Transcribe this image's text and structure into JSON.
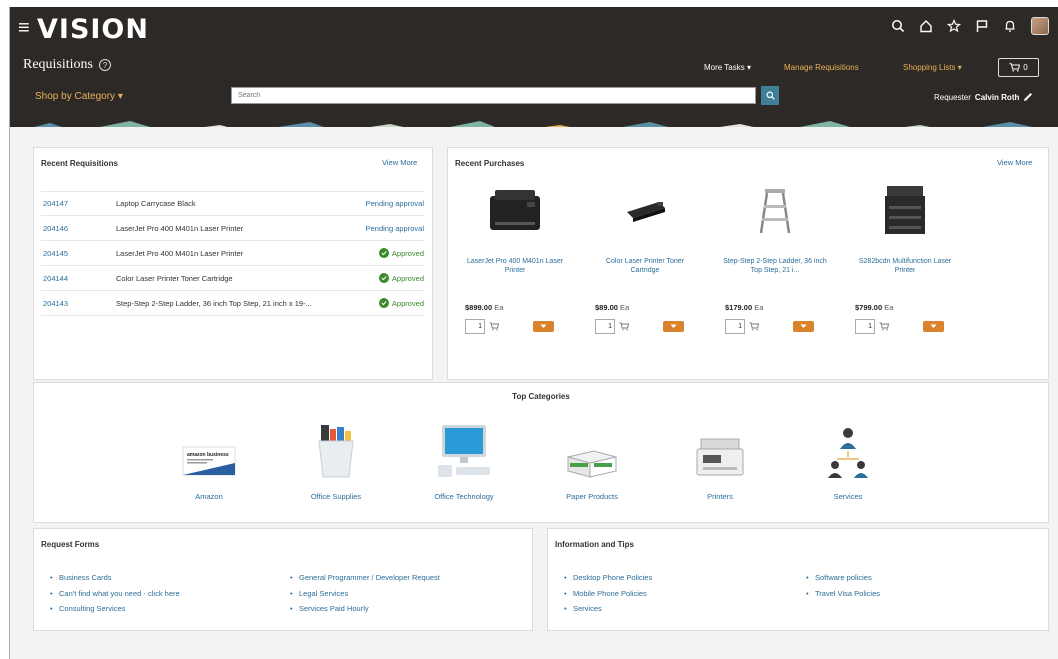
{
  "app": {
    "logo": "VISION",
    "page_title": "Requisitions",
    "icons": [
      "hamburger-icon",
      "search-icon",
      "home-icon",
      "star-icon",
      "flag-icon",
      "bell-icon",
      "avatar"
    ]
  },
  "header": {
    "more_tasks": "More Tasks ▾",
    "manage_requisitions": "Manage Requisitions",
    "shopping_lists": "Shopping Lists ▾",
    "cart_count": "0",
    "shop_by_category": "Shop by Category ▾",
    "search_placeholder": "Search",
    "requester_label": "Requester",
    "requester_name": "Calvin Roth"
  },
  "recent_requisitions": {
    "title": "Recent Requisitions",
    "view_more": "View More",
    "rows": [
      {
        "id": "204147",
        "desc": "Laptop Carrycase Black",
        "status": "Pending approval",
        "approved": false
      },
      {
        "id": "204146",
        "desc": "LaserJet Pro 400 M401n Laser Printer",
        "status": "Pending approval",
        "approved": false
      },
      {
        "id": "204145",
        "desc": "LaserJet Pro 400 M401n Laser Printer",
        "status": "Approved",
        "approved": true
      },
      {
        "id": "204144",
        "desc": "Color Laser Printer Toner Cartridge",
        "status": "Approved",
        "approved": true
      },
      {
        "id": "204143",
        "desc": "Step-Step 2-Step Ladder, 36 inch Top Step, 21 inch x 19-...",
        "status": "Approved",
        "approved": true
      }
    ]
  },
  "recent_purchases": {
    "title": "Recent Purchases",
    "view_more": "View More",
    "items": [
      {
        "name": "LaserJet Pro 400 M401n Laser Printer",
        "price": "$899.00",
        "uom": "Ea",
        "qty": "1",
        "icon": "laser-printer-image"
      },
      {
        "name": "Color Laser Printer Toner Cartridge",
        "price": "$89.00",
        "uom": "Ea",
        "qty": "1",
        "icon": "toner-cartridge-image"
      },
      {
        "name": "Step-Step 2-Step Ladder, 36 inch Top Step, 21 i...",
        "price": "$179.00",
        "uom": "Ea",
        "qty": "1",
        "icon": "ladder-image"
      },
      {
        "name": "S282bcdn Multifunction Laser Printer",
        "price": "$799.00",
        "uom": "Ea",
        "qty": "1",
        "icon": "multifunction-printer-image"
      }
    ]
  },
  "top_categories": {
    "title": "Top Categories",
    "items": [
      {
        "label": "Amazon",
        "icon": "amazon-business-image",
        "logo_text": "amazon business"
      },
      {
        "label": "Office Supplies",
        "icon": "office-supplies-image"
      },
      {
        "label": "Office Technology",
        "icon": "computer-monitor-image"
      },
      {
        "label": "Paper Products",
        "icon": "paper-ream-image"
      },
      {
        "label": "Printers",
        "icon": "printer-image"
      },
      {
        "label": "Services",
        "icon": "people-network-image"
      }
    ]
  },
  "request_forms": {
    "title": "Request Forms",
    "col1": [
      "Business Cards",
      "Can't find what you need - click here",
      "Consulting Services"
    ],
    "col2": [
      "General Programmer / Developer Request",
      "Legal Services",
      "Services Paid Hourly"
    ]
  },
  "info_tips": {
    "title": "Information and Tips",
    "col1": [
      "Desktop Phone Policies",
      "Mobile Phone Policies",
      "Services"
    ],
    "col2": [
      "Software policies",
      "Travel Visa Policies"
    ]
  },
  "colors": {
    "header_bg": "#2d2926",
    "accent_gold": "#e9b256",
    "link_blue": "#2a6e9b",
    "approved_green": "#3b8a2b",
    "add_orange": "#d9842c"
  }
}
